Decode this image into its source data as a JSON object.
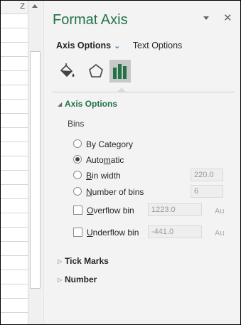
{
  "sheet": {
    "column_header": "Z"
  },
  "pane": {
    "title": "Format Axis",
    "tabs": [
      {
        "label": "Axis Options",
        "active": true
      },
      {
        "label": "Text Options",
        "active": false
      }
    ],
    "icon_tabs": [
      "paint-bucket-icon",
      "pentagon-icon",
      "bar-chart-icon"
    ],
    "sections": {
      "axis_options": {
        "label": "Axis Options",
        "bins_label": "Bins",
        "radios": [
          {
            "pre": "By Category",
            "ul": "",
            "post": "",
            "checked": false
          },
          {
            "pre": "Auto",
            "ul": "m",
            "post": "atic",
            "checked": true
          },
          {
            "pre": "",
            "ul": "B",
            "post": "in width",
            "checked": false,
            "value": "220.0"
          },
          {
            "pre": "",
            "ul": "N",
            "post": "umber of bins",
            "checked": false,
            "value": "6"
          }
        ],
        "checkboxes": [
          {
            "pre": "",
            "ul": "O",
            "post": "verflow bin",
            "checked": false,
            "value": "1223.0",
            "auto": "Au"
          },
          {
            "pre": "",
            "ul": "U",
            "post": "nderflow bin",
            "checked": false,
            "value": "-441.0",
            "auto": "Au"
          }
        ]
      },
      "tick_marks": {
        "label": "Tick Marks"
      },
      "number": {
        "label": "Number"
      }
    },
    "accent_color": "#217346"
  }
}
